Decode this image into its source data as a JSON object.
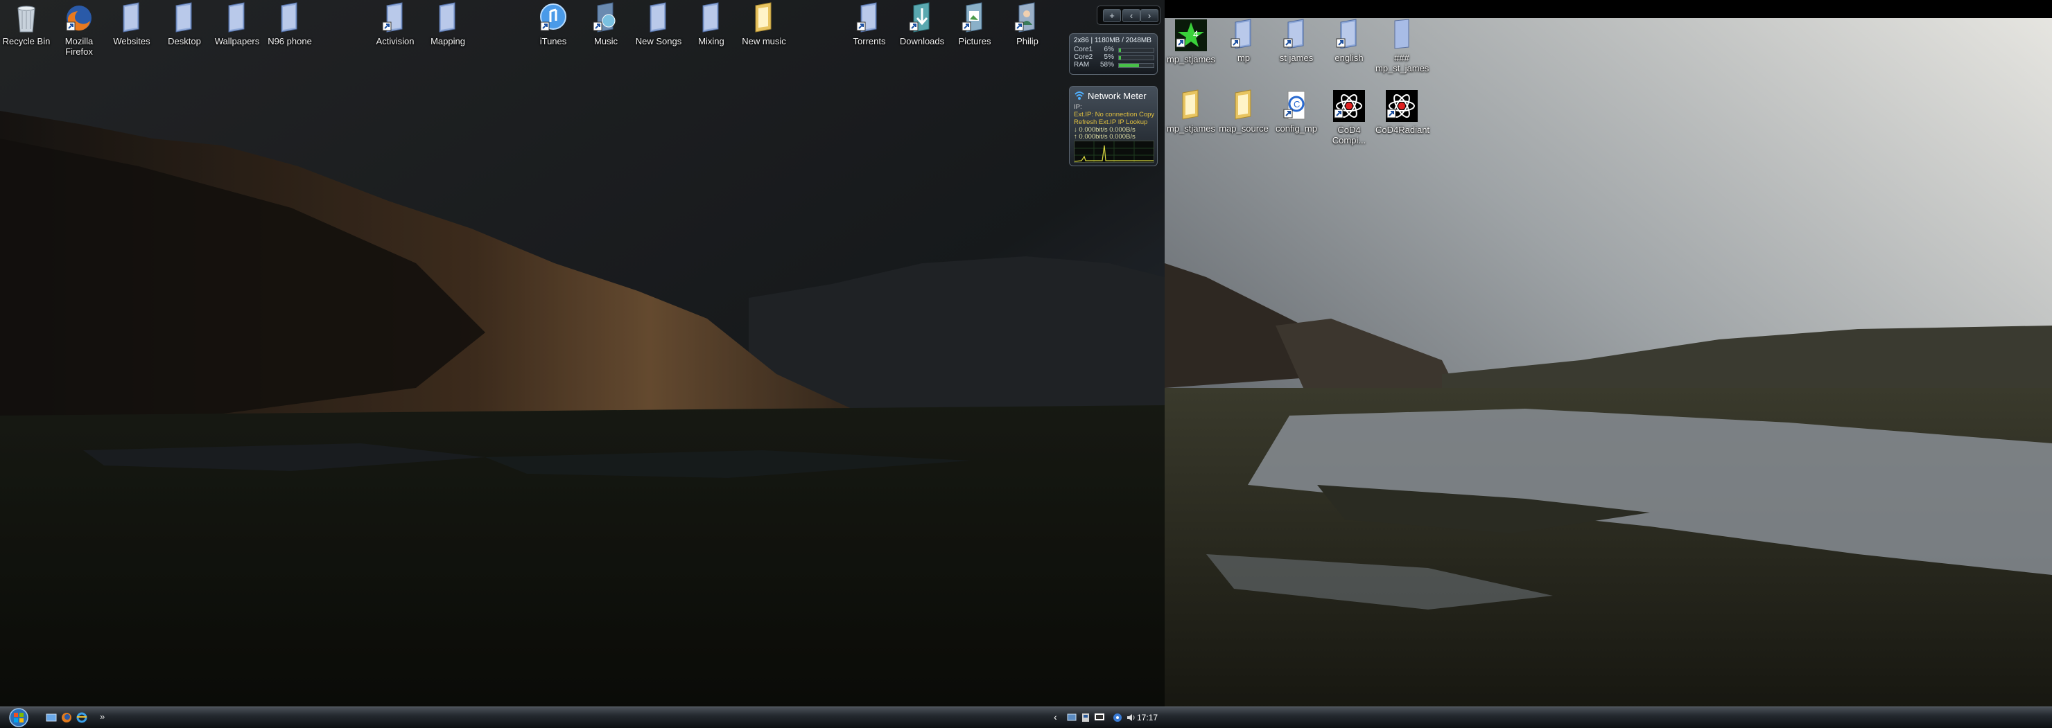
{
  "desktop_left": {
    "icons": [
      {
        "id": "recycle-bin",
        "label": "Recycle Bin",
        "type": "bin"
      },
      {
        "id": "mozilla-firefox",
        "label": "Mozilla Firefox",
        "type": "firefox"
      },
      {
        "id": "websites",
        "label": "Websites",
        "type": "folder-blue"
      },
      {
        "id": "desktop",
        "label": "Desktop",
        "type": "folder-blue"
      },
      {
        "id": "wallpapers",
        "label": "Wallpapers",
        "type": "folder-blue"
      },
      {
        "id": "n96-phone",
        "label": "N96 phone",
        "type": "folder-blue"
      },
      {
        "id": "activision",
        "label": "Activision",
        "type": "folder-blue-shortcut"
      },
      {
        "id": "mapping",
        "label": "Mapping",
        "type": "folder-blue"
      },
      {
        "id": "itunes",
        "label": "iTunes",
        "type": "itunes"
      },
      {
        "id": "music",
        "label": "Music",
        "type": "music"
      },
      {
        "id": "new-songs",
        "label": "New Songs",
        "type": "folder-blue"
      },
      {
        "id": "mixing",
        "label": "Mixing",
        "type": "folder-blue"
      },
      {
        "id": "new-music",
        "label": "New music",
        "type": "folder-yellow"
      },
      {
        "id": "torrents",
        "label": "Torrents",
        "type": "folder-blue-shortcut"
      },
      {
        "id": "downloads",
        "label": "Downloads",
        "type": "downloads"
      },
      {
        "id": "pictures",
        "label": "Pictures",
        "type": "pictures"
      },
      {
        "id": "philip",
        "label": "Philip",
        "type": "philip"
      }
    ]
  },
  "desktop_right": {
    "icons": [
      {
        "id": "mp-stjames-game",
        "label": "mp_stjames",
        "type": "cod-green"
      },
      {
        "id": "mp",
        "label": "mp",
        "type": "folder-blue-shortcut"
      },
      {
        "id": "st-james",
        "label": "st james",
        "type": "folder-blue-shortcut"
      },
      {
        "id": "english",
        "label": "english",
        "type": "folder-blue-shortcut"
      },
      {
        "id": "mp-st-james-file",
        "label": "### mp_st_james",
        "type": "file-blue"
      },
      {
        "id": "mp-stjames-folder",
        "label": "mp_stjames",
        "type": "folder-yellow"
      },
      {
        "id": "map-source",
        "label": "map_source",
        "type": "folder-yellow"
      },
      {
        "id": "config-mp",
        "label": "config_mp",
        "type": "config"
      },
      {
        "id": "cod4-compile",
        "label": "CoD4 Compi...",
        "type": "cod-atom"
      },
      {
        "id": "cod4-radiant",
        "label": "CoD4Radiant",
        "type": "cod-atom"
      }
    ]
  },
  "gadgets": {
    "toolbar": {
      "add": "+",
      "prev": "‹",
      "next": "›"
    },
    "cpu_meter": {
      "header": "2x86 | 1180MB / 2048MB",
      "rows": [
        {
          "label": "Core1",
          "value": "6%",
          "fraction": 0.06
        },
        {
          "label": "Core2",
          "value": "5%",
          "fraction": 0.05
        },
        {
          "label": "RAM",
          "value": "58%",
          "fraction": 0.58
        }
      ]
    },
    "network_meter": {
      "title": "Network Meter",
      "ip_line": "IP:",
      "ext_ip_line": "Ext.IP: No connection  Copy",
      "refresh_line": "Refresh Ext.IP    IP Lookup",
      "down_line": "0.000bit/s      0.000B/s",
      "up_line": "0.000bit/s      0.000B/s"
    }
  },
  "taskbar": {
    "clock": "17:17",
    "quick_launch": [
      "show-desktop-icon",
      "firefox-icon",
      "ie-icon"
    ],
    "overflow": "»"
  },
  "colors": {
    "taskbar": "#1b1f24",
    "accent": "#3a7bd5"
  }
}
